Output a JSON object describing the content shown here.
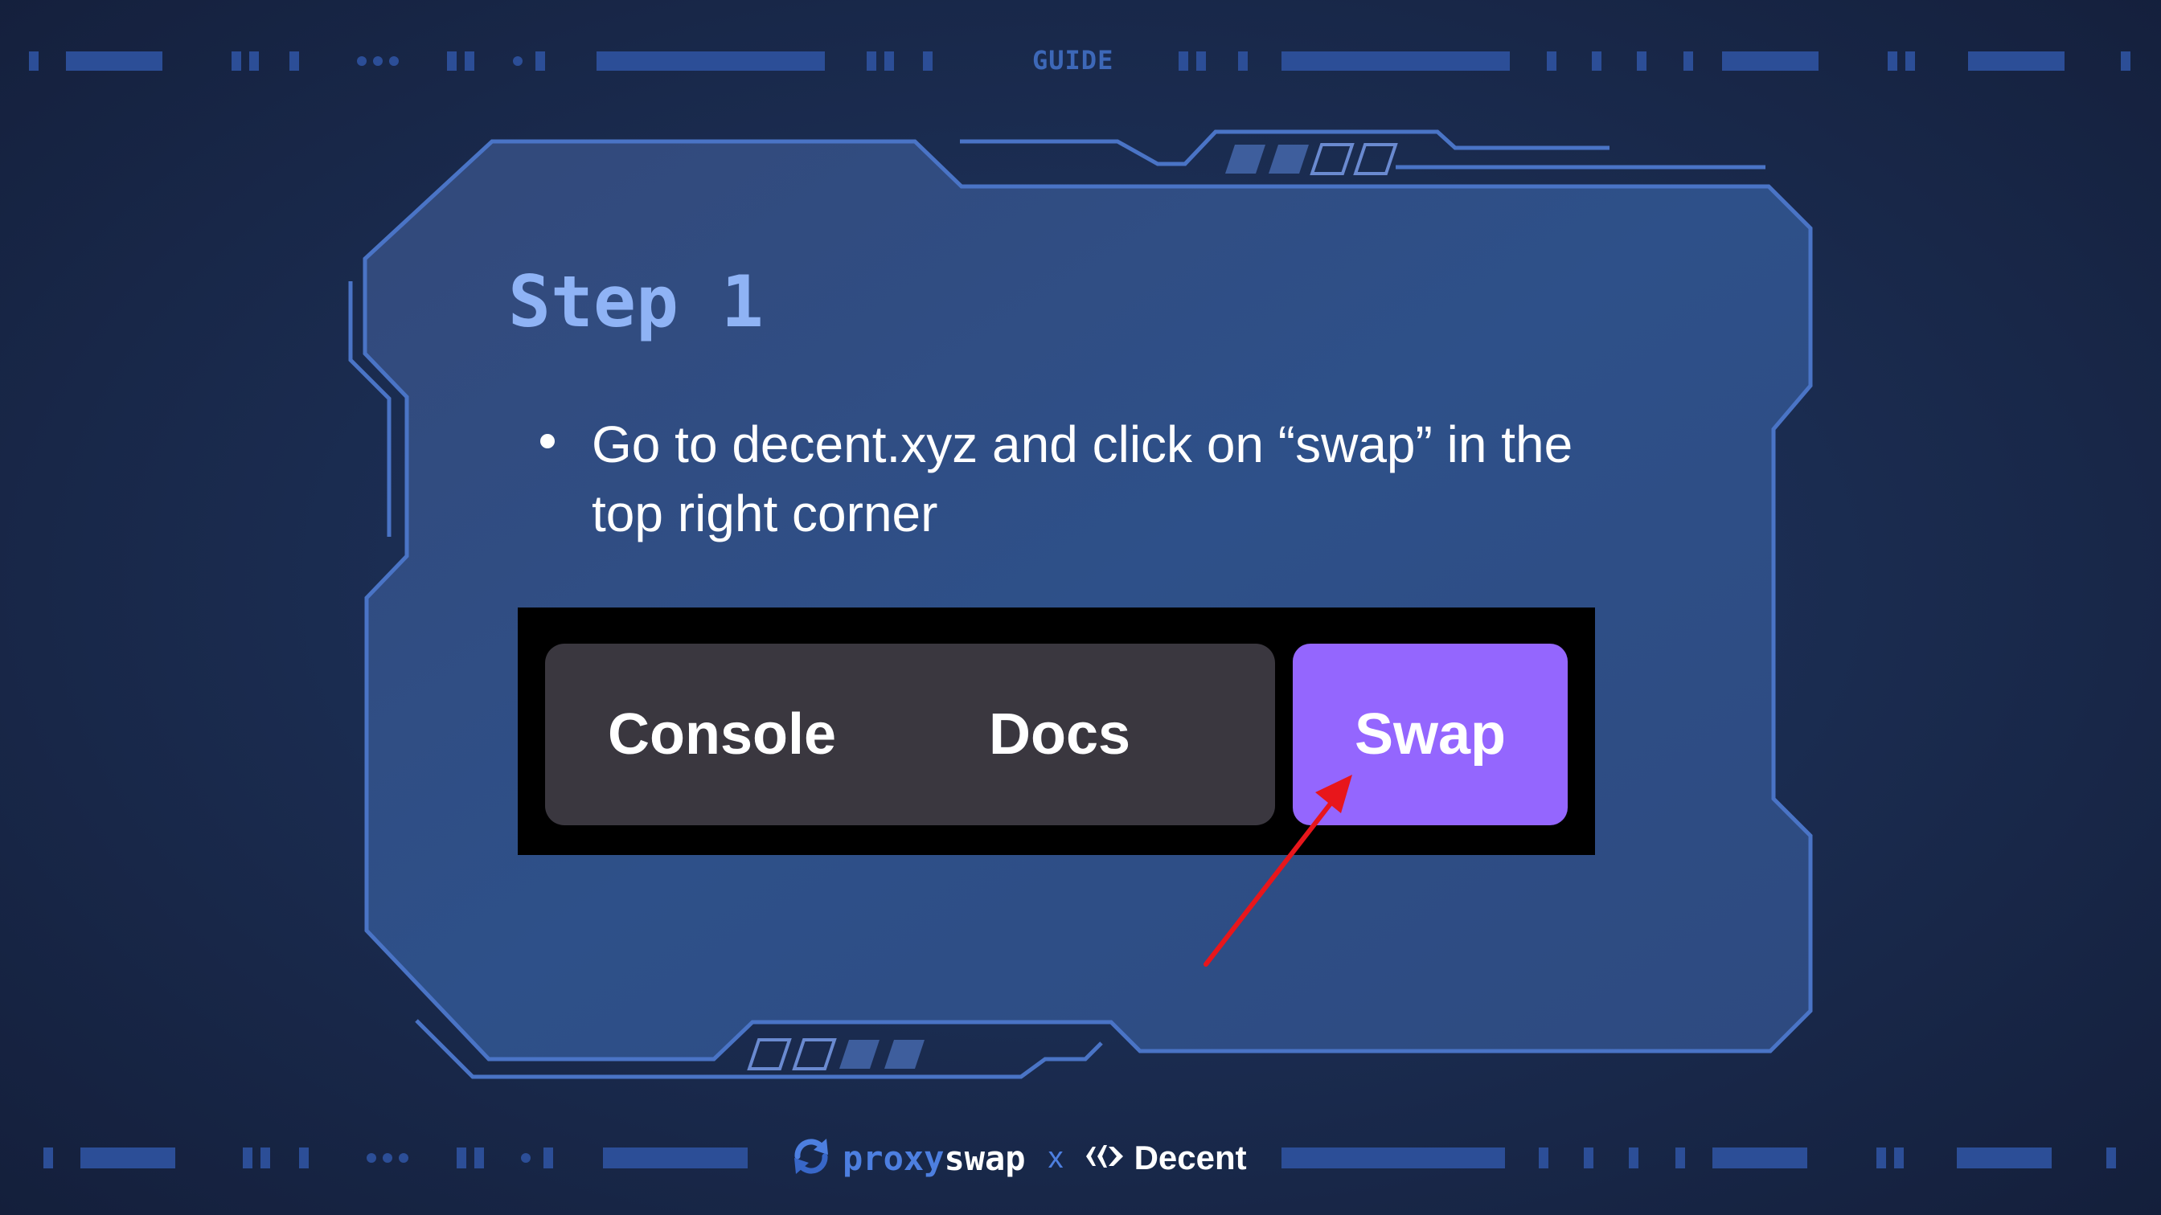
{
  "header": {
    "label": "GUIDE"
  },
  "card": {
    "title": "Step 1",
    "bullet": "Go to decent.xyz and click on “swap” in the top right corner"
  },
  "nav_screenshot": {
    "console_label": "Console",
    "docs_label": "Docs",
    "swap_label": "Swap",
    "swap_color": "#9466fe"
  },
  "footer": {
    "brand_part1": "proxy",
    "brand_part2": "swap",
    "separator": "x",
    "partner": "Decent"
  },
  "icons": {
    "proxyswap_logo": "circular-arrows-icon",
    "decent_logo": "decent-mark-icon",
    "pointer_arrow": "red-arrow-icon"
  },
  "colors": {
    "accent": "#4d7fe0",
    "title": "#8fb3f5",
    "arrow": "#e8161b"
  }
}
